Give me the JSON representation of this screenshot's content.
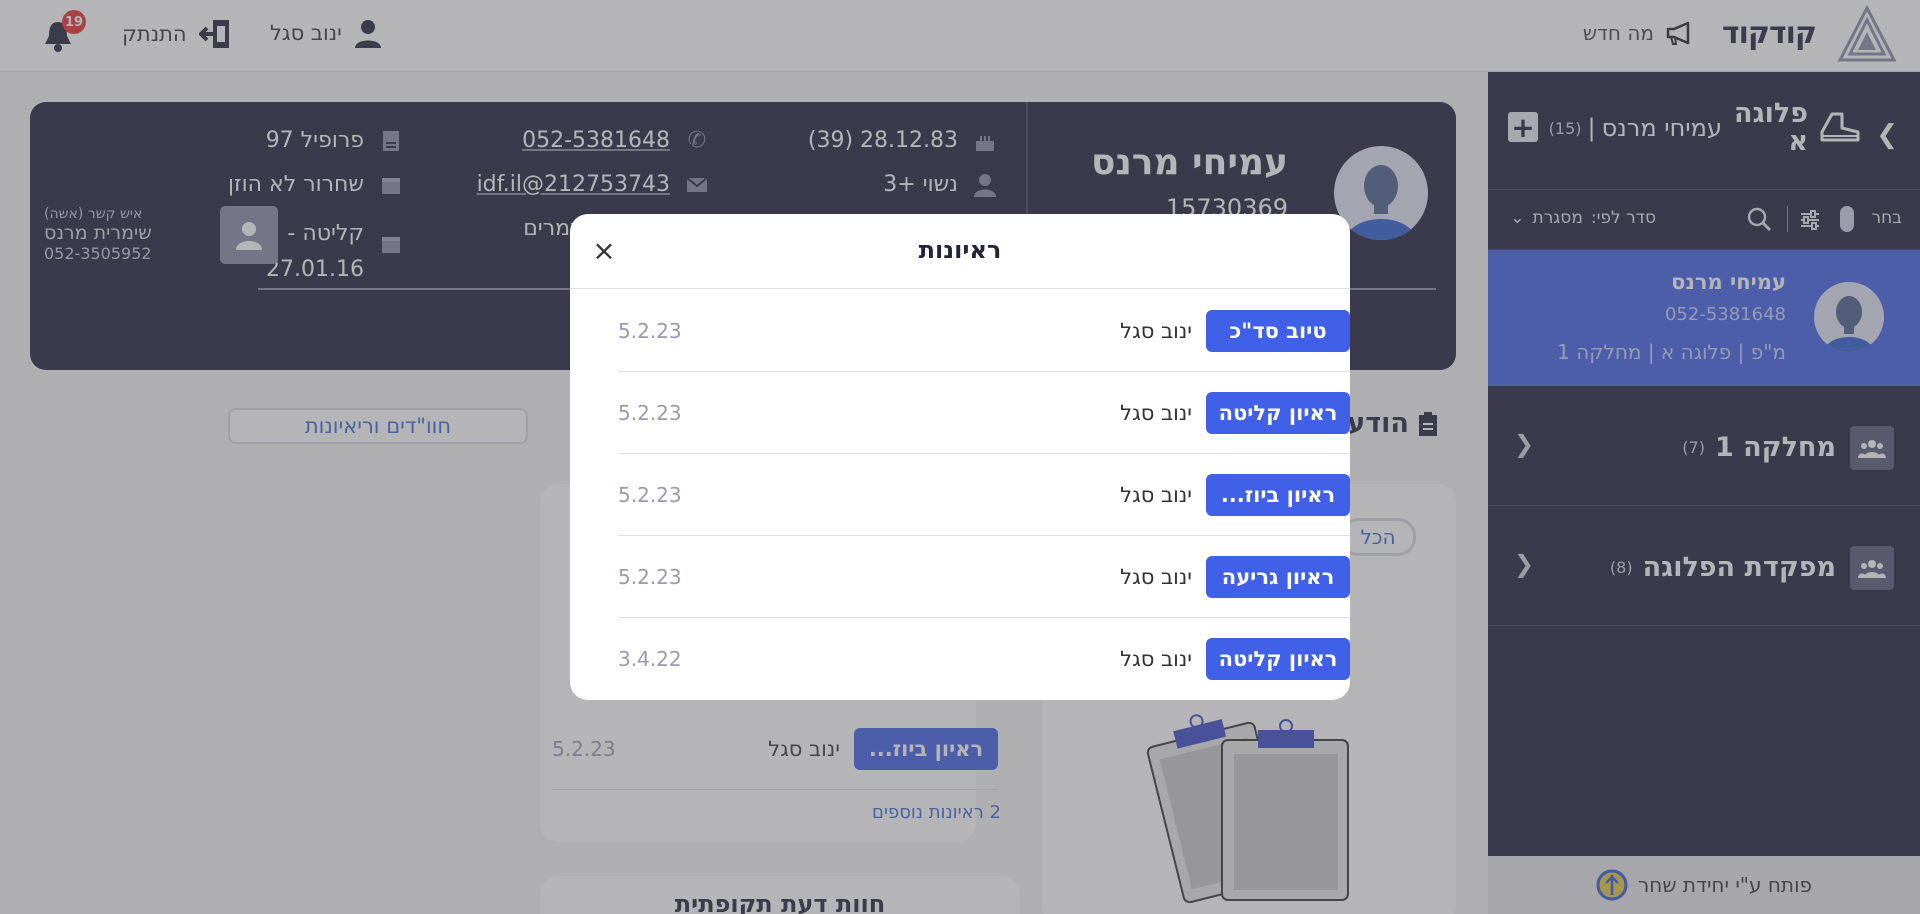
{
  "header": {
    "brand": "קודקוד",
    "whats_new": "מה חדש",
    "user_name": "ינוב סגל",
    "logout": "התנתק",
    "notifications_count": "19"
  },
  "sidebar": {
    "title": "פלוגה א",
    "subtitle_name": "עמיחי מרנס",
    "subtitle_count": "(15)",
    "choose_label": "בחר",
    "sort_label": "סדר לפי:",
    "sort_value": "מסגרת",
    "selected_card": {
      "name": "עמיחי מרנס",
      "phone": "052-5381648",
      "unit": "מ\"פ | פלוגה א | מחלקה 1"
    },
    "groups": [
      {
        "label": "מחלקה 1",
        "count": "(7)"
      },
      {
        "label": "מפקדת הפלוגה",
        "count": "(8)"
      }
    ],
    "footer": "פותח ע\"י יחידת שחר"
  },
  "profile": {
    "name": "עמיחי מרנס",
    "id": "15730369",
    "birth": "28.12.83 (39)",
    "marital": "נשוי +3",
    "phone": "052-5381648",
    "email": "212753743@idf.il",
    "partial_field": "ת תמרים",
    "profile": "פרופיל 97",
    "release": "שחרור לא הוזן",
    "intake_label": "קליטה -",
    "intake_date": "27.01.16",
    "contact_label": "איש קשר (אשה)",
    "contact_name": "שימרית מרנס",
    "contact_phone": "052-3505952"
  },
  "content": {
    "tab_label": "חוו\"דים וריאיונות",
    "notes_heading": "הודעו",
    "all_label": "הכל",
    "left_row": {
      "type": "ראיון ביוז...",
      "by": "ינוב סגל",
      "date": "5.2.23"
    },
    "more_interviews": "2 ראיונות נוספים",
    "bottom_heading": "חוות דעת תקופתית"
  },
  "modal": {
    "title": "ראיונות",
    "rows": [
      {
        "type": "טיוב סד\"כ",
        "by": "ינוב סגל",
        "date": "5.2.23"
      },
      {
        "type": "ראיון קליטה",
        "by": "ינוב סגל",
        "date": "5.2.23"
      },
      {
        "type": "ראיון ביוז...",
        "by": "ינוב סגל",
        "date": "5.2.23"
      },
      {
        "type": "ראיון גריעה",
        "by": "ינוב סגל",
        "date": "5.2.23"
      },
      {
        "type": "ראיון קליטה",
        "by": "ינוב סגל",
        "date": "3.4.22"
      }
    ]
  },
  "colors": {
    "navy": "#1f1f3d",
    "accent_blue": "#4160e8",
    "link_blue": "#3a6ad8",
    "badge_red": "#e5322d"
  }
}
